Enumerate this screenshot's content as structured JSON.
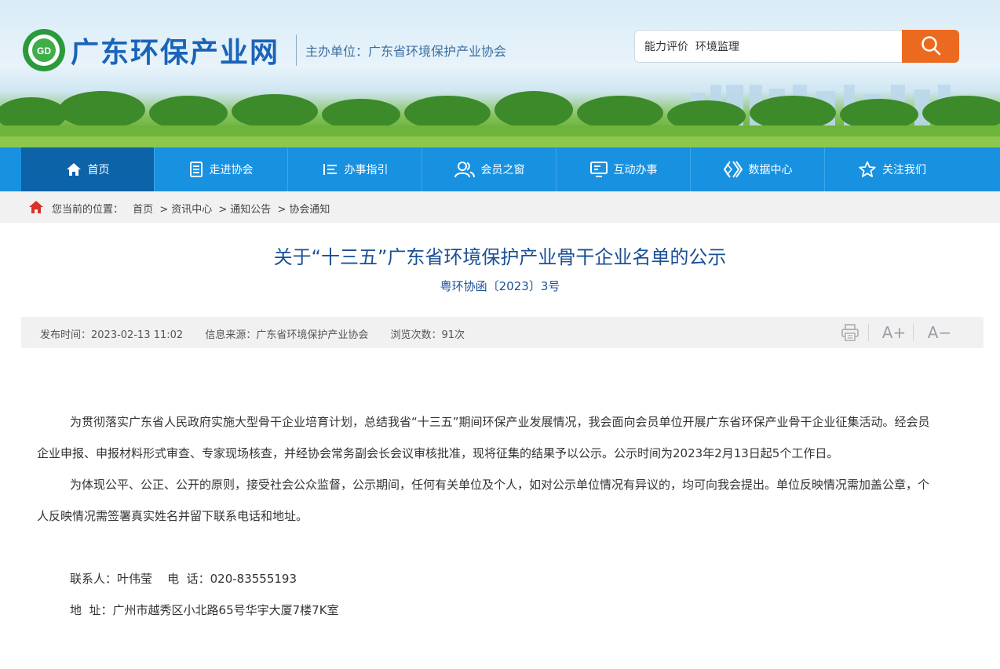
{
  "header": {
    "site_name": "广东环保产业网",
    "host": "主办单位：广东省环境保护产业协会",
    "search_value": "能力评价  环境监理"
  },
  "nav": {
    "items": [
      {
        "label": "首页",
        "icon": "home-icon"
      },
      {
        "label": "走进协会",
        "icon": "document-icon"
      },
      {
        "label": "办事指引",
        "icon": "list-icon"
      },
      {
        "label": "会员之窗",
        "icon": "users-icon"
      },
      {
        "label": "互动办事",
        "icon": "monitor-icon"
      },
      {
        "label": "数据中心",
        "icon": "chevrons-icon"
      },
      {
        "label": "关注我们",
        "icon": "star-icon"
      }
    ],
    "active_index": 0
  },
  "breadcrumb": {
    "prefix": "您当前的位置：",
    "items": [
      "首页",
      "资讯中心",
      "通知公告",
      "协会通知"
    ],
    "separator": ">"
  },
  "article": {
    "title": "关于“十三五”广东省环境保护产业骨干企业名单的公示",
    "doc_number": "粤环协函〔2023〕3号",
    "meta": {
      "publish_label": "发布时间：",
      "publish_time": "2023-02-13 11:02",
      "source_label": "信息来源：",
      "source": "广东省环境保护产业协会",
      "views_label": "浏览次数：",
      "views": "91次"
    },
    "tools": {
      "font_up": "A+",
      "font_down": "A−"
    },
    "paragraphs": [
      "为贯彻落实广东省人民政府实施大型骨干企业培育计划，总结我省“十三五”期间环保产业发展情况，我会面向会员单位开展广东省环保产业骨干企业征集活动。经会员企业申报、申报材料形式审查、专家现场核查，并经协会常务副会长会议审核批准，现将征集的结果予以公示。公示时间为2023年2月13日起5个工作日。",
      "为体现公平、公正、公开的原则，接受社会公众监督，公示期间，任何有关单位及个人，如对公示单位情况有异议的，均可向我会提出。单位反映情况需加盖公章，个人反映情况需签署真实姓名并留下联系电话和地址。"
    ],
    "contact": "联系人：叶伟莹    电  话：020-83555193",
    "address": "地  址：广州市越秀区小北路65号华宇大厦7楼7K室"
  },
  "colors": {
    "nav_bg": "#1891e0",
    "nav_active": "#0c63a8",
    "search_button": "#ec6a1f",
    "title": "#1a4f96"
  }
}
